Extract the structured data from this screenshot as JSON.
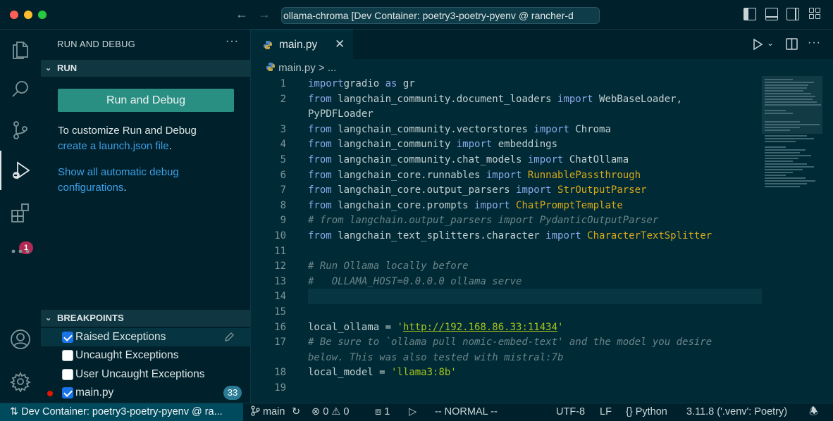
{
  "titlebar": {
    "command_center": "ollama-chroma [Dev Container: poetry3-poetry-pyenv @ rancher-d"
  },
  "activitybar": {
    "extensions_badge": "1"
  },
  "sidebar": {
    "title": "RUN AND DEBUG",
    "more": "···",
    "run_section": "RUN",
    "run_button": "Run and Debug",
    "customize_text": "To customize Run and Debug",
    "create_link": "create a launch.json file",
    "create_suffix": ".",
    "show_link_line1": "Show all automatic debug",
    "show_link_line2": "configurations",
    "show_suffix": ".",
    "breakpoints_section": "BREAKPOINTS",
    "breakpoints": [
      {
        "label": "Raised Exceptions",
        "checked": true
      },
      {
        "label": "Uncaught Exceptions",
        "checked": false
      },
      {
        "label": "User Uncaught Exceptions",
        "checked": false
      },
      {
        "label": "main.py",
        "checked": true,
        "count": "33"
      }
    ]
  },
  "editor": {
    "tab_label": "main.py",
    "breadcrumb_file": "main.py",
    "breadcrumb_sep": ">",
    "breadcrumb_more": "...",
    "lines": [
      {
        "n": "1",
        "code": [
          [
            "kw",
            "import"
          ],
          [
            "",
            "gradio "
          ],
          [
            "kw",
            "as"
          ],
          [
            "",
            " gr"
          ]
        ]
      },
      {
        "n": "2",
        "code": [
          [
            "kw",
            "from"
          ],
          [
            "",
            " langchain_community.document_loaders "
          ],
          [
            "kw",
            "import"
          ],
          [
            "",
            " WebBaseLoader,"
          ]
        ]
      },
      {
        "n": "",
        "code": [
          [
            "",
            "PyPDFLoader"
          ]
        ]
      },
      {
        "n": "3",
        "code": [
          [
            "kw",
            "from"
          ],
          [
            "",
            " langchain_community.vectorstores "
          ],
          [
            "kw",
            "import"
          ],
          [
            "",
            " Chroma"
          ]
        ]
      },
      {
        "n": "4",
        "code": [
          [
            "kw",
            "from"
          ],
          [
            "",
            " langchain_community "
          ],
          [
            "kw",
            "import"
          ],
          [
            "",
            " embeddings"
          ]
        ]
      },
      {
        "n": "5",
        "code": [
          [
            "kw",
            "from"
          ],
          [
            "",
            " langchain_community.chat_models "
          ],
          [
            "kw",
            "import"
          ],
          [
            "",
            " ChatOllama"
          ]
        ]
      },
      {
        "n": "6",
        "code": [
          [
            "kw",
            "from"
          ],
          [
            "",
            " langchain_core.runnables "
          ],
          [
            "kw",
            "import"
          ],
          [
            "",
            " "
          ],
          [
            "cls",
            "RunnablePassthrough"
          ]
        ]
      },
      {
        "n": "7",
        "code": [
          [
            "kw",
            "from"
          ],
          [
            "",
            " langchain_core.output_parsers "
          ],
          [
            "kw",
            "import"
          ],
          [
            "",
            " "
          ],
          [
            "cls",
            "StrOutputParser"
          ]
        ]
      },
      {
        "n": "8",
        "code": [
          [
            "kw",
            "from"
          ],
          [
            "",
            " langchain_core.prompts "
          ],
          [
            "kw",
            "import"
          ],
          [
            "",
            " "
          ],
          [
            "cls",
            "ChatPromptTemplate"
          ]
        ]
      },
      {
        "n": "9",
        "code": [
          [
            "cmt",
            "# from langchain.output_parsers import PydanticOutputParser"
          ]
        ]
      },
      {
        "n": "10",
        "code": [
          [
            "kw",
            "from"
          ],
          [
            "",
            " langchain_text_splitters.character "
          ],
          [
            "kw",
            "import"
          ],
          [
            "",
            " "
          ],
          [
            "cls",
            "CharacterTextSplitter"
          ]
        ]
      },
      {
        "n": "11",
        "code": []
      },
      {
        "n": "12",
        "code": [
          [
            "cmt",
            "# Run Ollama locally before"
          ]
        ]
      },
      {
        "n": "13",
        "code": [
          [
            "cmt",
            "#   OLLAMA_HOST=0.0.0.0 ollama serve"
          ]
        ]
      },
      {
        "n": "14",
        "code": [],
        "highlight": true
      },
      {
        "n": "15",
        "code": []
      },
      {
        "n": "16",
        "code": [
          [
            "",
            "local_ollama = "
          ],
          [
            "str",
            "'"
          ],
          [
            "url",
            "http://192.168.86.33:11434"
          ],
          [
            "str",
            "'"
          ]
        ]
      },
      {
        "n": "17",
        "code": [
          [
            "cmt",
            "# Be sure to `ollama pull nomic-embed-text' and the model you desire"
          ]
        ]
      },
      {
        "n": "",
        "code": [
          [
            "cmt",
            "below. This was also tested with mistral:7b"
          ]
        ]
      },
      {
        "n": "18",
        "code": [
          [
            "",
            "local_model = "
          ],
          [
            "str",
            "'llama3:8b'"
          ]
        ]
      },
      {
        "n": "19",
        "code": []
      }
    ]
  },
  "statusbar": {
    "remote": "Dev Container: poetry3-poetry-pyenv @ ra...",
    "branch": "main",
    "errors": "0",
    "warnings": "0",
    "ports": "1",
    "mode": "-- NORMAL --",
    "encoding": "UTF-8",
    "eol": "LF",
    "language": "Python",
    "interpreter": "3.11.8 ('.venv': Poetry)"
  },
  "colors": {
    "background": "#002b36",
    "sidebar": "#00212b",
    "accent_button": "#2a8f83",
    "link": "#3e9ee6",
    "keyword": "#8ca7e8",
    "class": "#d9a81a",
    "string": "#a6c21c",
    "badge": "#b22a52"
  },
  "icons": [
    "files-icon",
    "search-icon",
    "source-control-icon",
    "run-debug-icon",
    "extensions-icon",
    "more-icon",
    "account-icon",
    "settings-icon",
    "python-icon",
    "run-icon",
    "split-editor-icon",
    "branch-icon",
    "sync-icon",
    "error-icon",
    "warning-icon",
    "ports-icon",
    "debug-icon",
    "bell-icon"
  ]
}
